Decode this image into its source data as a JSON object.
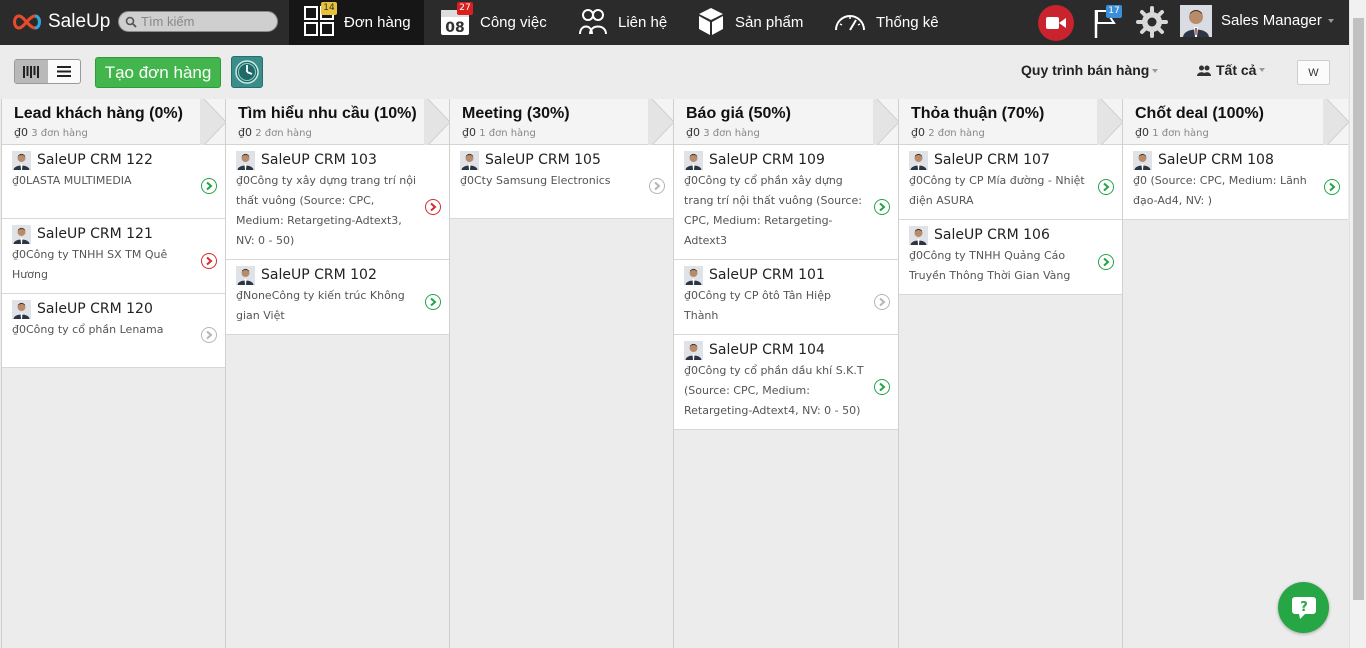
{
  "app": {
    "name": "SaleUp"
  },
  "search": {
    "placeholder": "Tìm kiếm"
  },
  "nav": [
    {
      "label": "Đơn hàng",
      "icon": "orders-grid-icon",
      "badge": "14",
      "active": true
    },
    {
      "label": "Công việc",
      "icon": "calendar-icon",
      "badge": "27",
      "date": "08"
    },
    {
      "label": "Liên hệ",
      "icon": "contacts-icon"
    },
    {
      "label": "Sản phẩm",
      "icon": "box-icon"
    },
    {
      "label": "Thống kê",
      "icon": "speedometer-icon"
    }
  ],
  "top_right": {
    "flag_badge": "17",
    "user_name": "Sales Manager"
  },
  "toolbar": {
    "create_label": "Tạo đơn hàng",
    "process_label": "Quy trình bán hàng",
    "filter_label": "Tất cả",
    "w_label": "W"
  },
  "colors": {
    "accent_green": "#42b54d",
    "topbar": "#2b2b2b",
    "alert_red": "#c9232d"
  },
  "columns": [
    {
      "title": "Lead khách hàng (0%)",
      "value": "₫0",
      "count": "3 đơn hàng",
      "cards": [
        {
          "title": "SaleUP CRM 122",
          "desc": "₫0LASTA MULTIMEDIA",
          "status": "green"
        },
        {
          "title": "SaleUP CRM 121",
          "desc": "₫0Công ty TNHH SX TM Quê Hương",
          "status": "red"
        },
        {
          "title": "SaleUP CRM 120",
          "desc": "₫0Công ty cổ phần Lenama",
          "status": "gray"
        }
      ]
    },
    {
      "title": "Tìm hiểu nhu cầu (10%)",
      "value": "₫0",
      "count": "2 đơn hàng",
      "cards": [
        {
          "title": "SaleUP CRM 103",
          "desc": "₫0Công ty xây dựng trang trí nội thất vuông (Source: CPC, Medium: Retargeting-Adtext3, NV: 0 - 50)",
          "status": "red"
        },
        {
          "title": "SaleUP CRM 102",
          "desc": "₫NoneCông ty kiến trúc Không gian Việt",
          "status": "green"
        }
      ]
    },
    {
      "title": "Meeting (30%)",
      "value": "₫0",
      "count": "1 đơn hàng",
      "cards": [
        {
          "title": "SaleUP CRM 105",
          "desc": "₫0Cty Samsung Electronics",
          "status": "gray"
        }
      ]
    },
    {
      "title": "Báo giá (50%)",
      "value": "₫0",
      "count": "3 đơn hàng",
      "cards": [
        {
          "title": "SaleUP CRM 109",
          "desc": "₫0Công ty cổ phần xây dựng trang trí nội thất vuông (Source: CPC, Medium: Retargeting-Adtext3",
          "status": "green"
        },
        {
          "title": "SaleUP CRM 101",
          "desc": "₫0Công ty CP ôtô Tân Hiệp Thành",
          "status": "gray",
          "min_height": 74
        },
        {
          "title": "SaleUP CRM 104",
          "desc": "₫0Công ty cổ phần dầu khí S.K.T (Source: CPC, Medium: Retargeting-Adtext4, NV: 0 - 50)",
          "status": "green"
        }
      ]
    },
    {
      "title": "Thỏa thuận (70%)",
      "value": "₫0",
      "count": "2 đơn hàng",
      "cards": [
        {
          "title": "SaleUP CRM 107",
          "desc": "₫0Công ty CP Mía đường - Nhiệt điện ASURA",
          "status": "green"
        },
        {
          "title": "SaleUP CRM 106",
          "desc": "₫0Công ty TNHH Quảng Cáo Truyền Thông Thời Gian Vàng",
          "status": "green"
        }
      ]
    },
    {
      "title": "Chốt deal (100%)",
      "value": "₫0",
      "count": "1 đơn hàng",
      "cards": [
        {
          "title": "SaleUP CRM 108",
          "desc": "₫0 (Source: CPC, Medium: Lãnh đạo-Ad4, NV: )",
          "status": "green"
        }
      ]
    }
  ]
}
